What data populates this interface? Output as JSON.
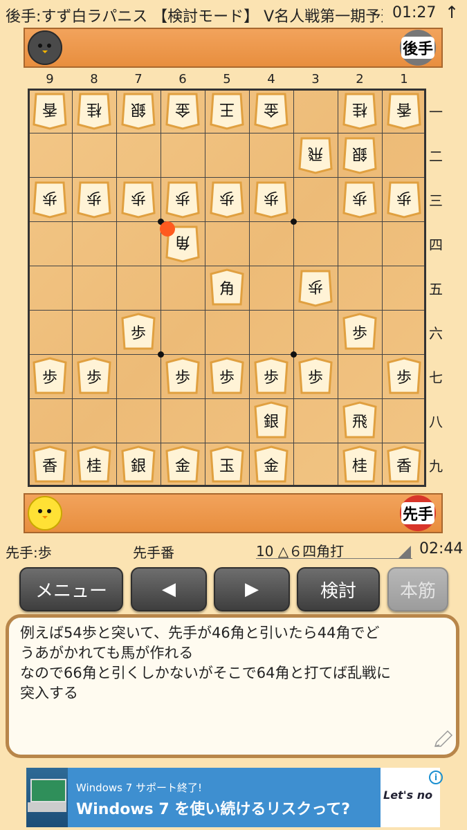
{
  "status_bar": {
    "title": "後手:すず白ラパニス 【検討モード】 V名人戦第一期予選",
    "clock": "01:27"
  },
  "players": {
    "gote_label": "後手",
    "sente_label": "先手"
  },
  "board": {
    "col_labels": [
      "9",
      "8",
      "7",
      "6",
      "5",
      "4",
      "3",
      "2",
      "1"
    ],
    "row_labels": [
      "一",
      "二",
      "三",
      "四",
      "五",
      "六",
      "七",
      "八",
      "九"
    ],
    "pieces": [
      {
        "col": 9,
        "row": 1,
        "kanji": "香",
        "side": "gote"
      },
      {
        "col": 8,
        "row": 1,
        "kanji": "桂",
        "side": "gote"
      },
      {
        "col": 7,
        "row": 1,
        "kanji": "銀",
        "side": "gote"
      },
      {
        "col": 6,
        "row": 1,
        "kanji": "金",
        "side": "gote"
      },
      {
        "col": 5,
        "row": 1,
        "kanji": "王",
        "side": "gote"
      },
      {
        "col": 4,
        "row": 1,
        "kanji": "金",
        "side": "gote"
      },
      {
        "col": 2,
        "row": 1,
        "kanji": "桂",
        "side": "gote"
      },
      {
        "col": 1,
        "row": 1,
        "kanji": "香",
        "side": "gote"
      },
      {
        "col": 3,
        "row": 2,
        "kanji": "飛",
        "side": "gote"
      },
      {
        "col": 2,
        "row": 2,
        "kanji": "銀",
        "side": "gote"
      },
      {
        "col": 9,
        "row": 3,
        "kanji": "歩",
        "side": "gote"
      },
      {
        "col": 8,
        "row": 3,
        "kanji": "歩",
        "side": "gote"
      },
      {
        "col": 7,
        "row": 3,
        "kanji": "歩",
        "side": "gote"
      },
      {
        "col": 6,
        "row": 3,
        "kanji": "歩",
        "side": "gote"
      },
      {
        "col": 5,
        "row": 3,
        "kanji": "歩",
        "side": "gote"
      },
      {
        "col": 4,
        "row": 3,
        "kanji": "歩",
        "side": "gote"
      },
      {
        "col": 2,
        "row": 3,
        "kanji": "歩",
        "side": "gote"
      },
      {
        "col": 1,
        "row": 3,
        "kanji": "歩",
        "side": "gote"
      },
      {
        "col": 6,
        "row": 4,
        "kanji": "角",
        "side": "gote"
      },
      {
        "col": 5,
        "row": 5,
        "kanji": "角",
        "side": "sente"
      },
      {
        "col": 3,
        "row": 5,
        "kanji": "歩",
        "side": "gote"
      },
      {
        "col": 7,
        "row": 6,
        "kanji": "歩",
        "side": "sente"
      },
      {
        "col": 2,
        "row": 6,
        "kanji": "歩",
        "side": "sente"
      },
      {
        "col": 9,
        "row": 7,
        "kanji": "歩",
        "side": "sente"
      },
      {
        "col": 8,
        "row": 7,
        "kanji": "歩",
        "side": "sente"
      },
      {
        "col": 6,
        "row": 7,
        "kanji": "歩",
        "side": "sente"
      },
      {
        "col": 5,
        "row": 7,
        "kanji": "歩",
        "side": "sente"
      },
      {
        "col": 4,
        "row": 7,
        "kanji": "歩",
        "side": "sente"
      },
      {
        "col": 3,
        "row": 7,
        "kanji": "歩",
        "side": "sente"
      },
      {
        "col": 1,
        "row": 7,
        "kanji": "歩",
        "side": "sente"
      },
      {
        "col": 4,
        "row": 8,
        "kanji": "銀",
        "side": "sente"
      },
      {
        "col": 2,
        "row": 8,
        "kanji": "飛",
        "side": "sente"
      },
      {
        "col": 9,
        "row": 9,
        "kanji": "香",
        "side": "sente"
      },
      {
        "col": 8,
        "row": 9,
        "kanji": "桂",
        "side": "sente"
      },
      {
        "col": 7,
        "row": 9,
        "kanji": "銀",
        "side": "sente"
      },
      {
        "col": 6,
        "row": 9,
        "kanji": "金",
        "side": "sente"
      },
      {
        "col": 5,
        "row": 9,
        "kanji": "玉",
        "side": "sente"
      },
      {
        "col": 4,
        "row": 9,
        "kanji": "金",
        "side": "sente"
      },
      {
        "col": 2,
        "row": 9,
        "kanji": "桂",
        "side": "sente"
      },
      {
        "col": 1,
        "row": 9,
        "kanji": "香",
        "side": "sente"
      }
    ],
    "last_move_marker": {
      "col": 6,
      "row": 4
    },
    "colors": {
      "last_move": "#FF5A1F",
      "piece_face": "#FFF3D6",
      "piece_edge": "#E0A040"
    }
  },
  "info_bar": {
    "sente_hand": "先手:歩",
    "turn": "先手番",
    "move": "10 △６四角打",
    "time": "02:44"
  },
  "buttons": {
    "menu": "メニュー",
    "prev": "◀",
    "next": "▶",
    "analyze": "検討",
    "mainline": "本筋"
  },
  "comment": "例えば54歩と突いて、先手が46角と引いたら44角でど\nうあがかれても馬が作れる\nなので66角と引くしかないがそこで64角と打てば乱戦に\n突入する",
  "ad": {
    "line1": "Windows 7 サポート終了!",
    "line2": "Windows 7 を使い続けるリスクって?",
    "brand": "Let's no",
    "info_icon": "i"
  }
}
